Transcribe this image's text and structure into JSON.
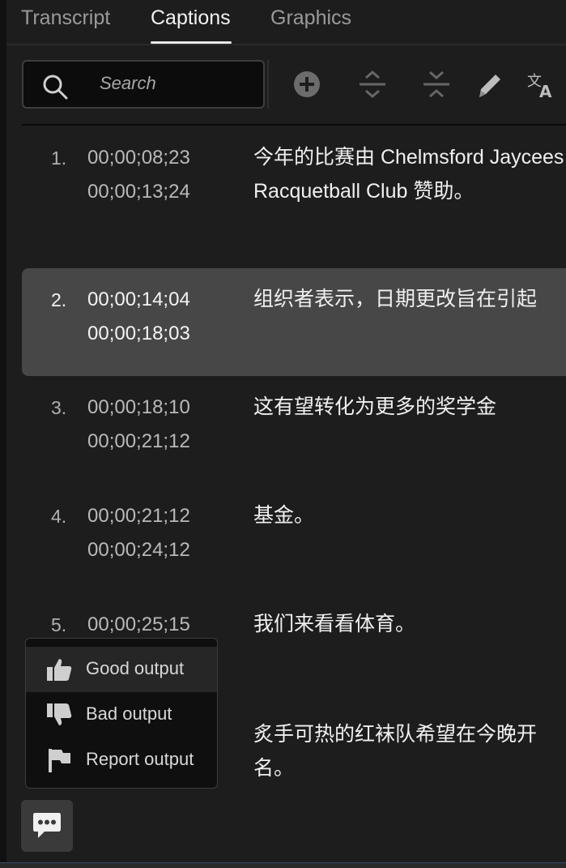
{
  "tabs": [
    {
      "label": "Transcript",
      "active": false
    },
    {
      "label": "Captions",
      "active": true
    },
    {
      "label": "Graphics",
      "active": false
    }
  ],
  "toolbar": {
    "search_placeholder": "Search",
    "icons": [
      "add-caption-icon",
      "split-caption-icon",
      "merge-caption-icon",
      "edit-icon",
      "translate-icon"
    ]
  },
  "captions": [
    {
      "index": "1.",
      "start": "00;00;08;23",
      "end": "00;00;13;24",
      "text_lines": [
        "今年的比赛由 Chelmsford Jaycees",
        "Racquetball Club 赞助。"
      ],
      "selected": false
    },
    {
      "index": "2.",
      "start": "00;00;14;04",
      "end": "00;00;18;03",
      "text_lines": [
        "组织者表示，日期更改旨在引起"
      ],
      "selected": true
    },
    {
      "index": "3.",
      "start": "00;00;18;10",
      "end": "00;00;21;12",
      "text_lines": [
        "这有望转化为更多的奖学金"
      ],
      "selected": false
    },
    {
      "index": "4.",
      "start": "00;00;21;12",
      "end": "00;00;24;12",
      "text_lines": [
        "基金。"
      ],
      "selected": false
    },
    {
      "index": "5.",
      "start": "00;00;25;15",
      "end": "",
      "text_lines": [
        "我们来看看体育。"
      ],
      "selected": false
    },
    {
      "index": "",
      "start": "",
      "end": "",
      "text_lines": [
        "炙手可热的红袜队希望在今晚开",
        "名。"
      ],
      "selected": false
    }
  ],
  "feedback_menu": {
    "items": [
      {
        "label": "Good output",
        "icon": "thumbs-up-icon"
      },
      {
        "label": "Bad output",
        "icon": "thumbs-down-icon"
      },
      {
        "label": "Report output",
        "icon": "flag-icon"
      }
    ]
  },
  "colors": {
    "background": "#1d1d1d",
    "selected_row": "#474747",
    "search_bg": "#0c0c0c"
  }
}
